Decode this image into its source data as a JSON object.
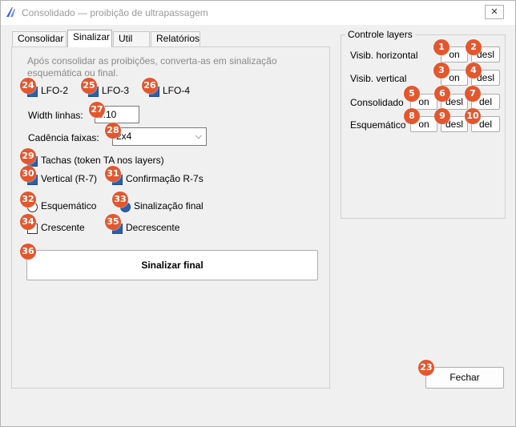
{
  "window": {
    "title": "Consolidado — proibição de ultrapassagem",
    "close_label": "✕"
  },
  "tabs": [
    {
      "label": "Consolidar"
    },
    {
      "label": "Sinalizar",
      "active": true
    },
    {
      "label": "Util"
    },
    {
      "label": "Relatórios"
    }
  ],
  "sinalizar": {
    "hint": "Após consolidar as proibições, converta-as em sinalização esquemática ou final.",
    "lfo": [
      {
        "label": "LFO-2",
        "checked": true
      },
      {
        "label": "LFO-3",
        "checked": true
      },
      {
        "label": "LFO-4",
        "checked": true
      }
    ],
    "width_label": "Width linhas:",
    "width_value": "0.10",
    "cadencia_label": "Cadência faixas:",
    "cadencia_value": "2x4",
    "tachas_label": "Tachas (token TA nos layers)",
    "vertical_label": "Vertical (R-7)",
    "confirmacao_label": "Confirmação R-7s",
    "esquematico_label": "Esquemático",
    "sinalizacao_final_label": "Sinalização final",
    "crescente_label": "Crescente",
    "decrescente_label": "Decrescente",
    "action_label": "Sinalizar final"
  },
  "layers": {
    "title": "Controle layers",
    "rows": [
      {
        "label": "Visib. horizontal",
        "buttons": [
          "on",
          "desl"
        ]
      },
      {
        "label": "Visib. vertical",
        "buttons": [
          "on",
          "desl"
        ]
      },
      {
        "label": "Consolidado",
        "buttons": [
          "on",
          "desl",
          "del"
        ]
      },
      {
        "label": "Esquemático",
        "buttons": [
          "on",
          "desl",
          "del"
        ]
      }
    ]
  },
  "footer": {
    "close_label": "Fechar"
  },
  "markers": [
    "1",
    "2",
    "3",
    "4",
    "5",
    "6",
    "7",
    "8",
    "9",
    "10",
    "23",
    "24",
    "25",
    "26",
    "27",
    "28",
    "29",
    "30",
    "31",
    "32",
    "33",
    "34",
    "35",
    "36"
  ],
  "colors": {
    "marker": "#e4572e",
    "checkbox_checked": "#2f5fa8",
    "app_icon": "#3b5bdb"
  }
}
